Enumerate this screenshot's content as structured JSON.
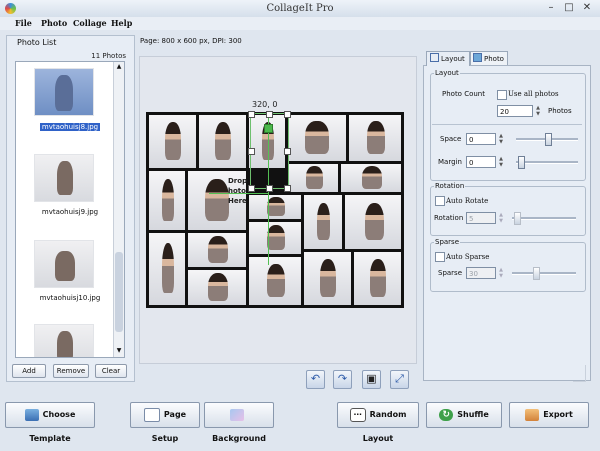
{
  "window": {
    "title": "CollageIt Pro"
  },
  "menu": [
    "File",
    "Photo",
    "Collage",
    "Help"
  ],
  "photo_list": {
    "title": "Photo List",
    "count": "11 Photos",
    "items": [
      {
        "label": "mvtaohuisj8.jpg",
        "selected": true
      },
      {
        "label": "mvtaohuisj9.jpg",
        "selected": false
      },
      {
        "label": "mvtaohuisj10.jpg",
        "selected": false
      }
    ],
    "buttons": {
      "add": "Add",
      "remove": "Remove",
      "clear": "Clear"
    }
  },
  "page_info": "Page: 800 x 600 px, DPI: 300",
  "canvas": {
    "coord": "320, 0",
    "drop_lines": [
      "Drop",
      "hoto",
      "Here"
    ]
  },
  "tabs": {
    "layout": "Layout",
    "photo": "Photo"
  },
  "layout_group": {
    "title": "Layout",
    "photo_count_label": "Photo Count",
    "use_all_label": "Use all photos",
    "use_all_checked": false,
    "photo_count": "20",
    "photos_unit": "Photos",
    "space_label": "Space",
    "space": "0",
    "margin_label": "Margin",
    "margin": "0"
  },
  "rotation_group": {
    "title": "Rotation",
    "auto_label": "Auto Rotate",
    "auto_checked": false,
    "rotation_label": "Rotation",
    "rotation": "5"
  },
  "sparse_group": {
    "title": "Sparse",
    "auto_label": "Auto Sparse",
    "auto_checked": false,
    "sparse_label": "Sparse",
    "sparse": "30"
  },
  "bottom": {
    "choose_template": "Choose Template",
    "page_setup": "Page Setup",
    "background": "Background",
    "random_layout": "Random Layout",
    "shuffle": "Shuffle",
    "export": "Export"
  },
  "colors": {
    "selection": "#2f62c8",
    "guide": "#54c054",
    "collage_border": "#111111"
  }
}
